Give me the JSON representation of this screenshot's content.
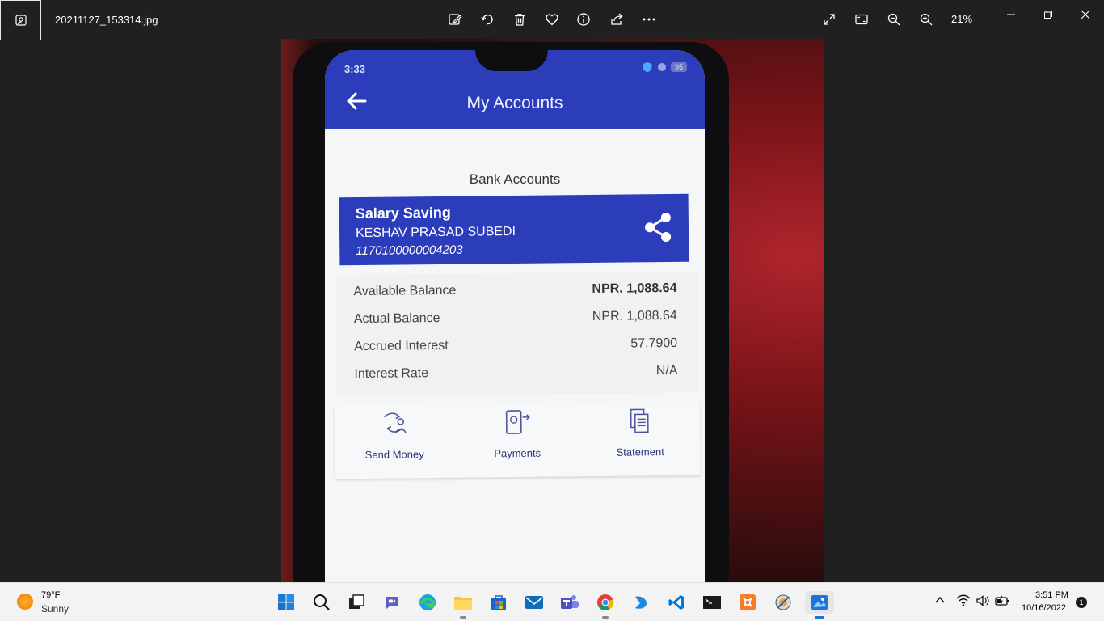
{
  "titlebar": {
    "filename": "20211127_153314.jpg",
    "zoom": "21%"
  },
  "phone": {
    "status_time": "3:33",
    "battery": "95",
    "app_title": "My Accounts",
    "section_title": "Bank Accounts",
    "account": {
      "name": "Salary Saving",
      "holder": "KESHAV PRASAD  SUBEDI",
      "number": "1170100000004203"
    },
    "balances": [
      {
        "label": "Available Balance",
        "value": "NPR. 1,088.64"
      },
      {
        "label": "Actual Balance",
        "value": "NPR. 1,088.64"
      },
      {
        "label": "Accrued Interest",
        "value": "57.7900"
      },
      {
        "label": "Interest Rate",
        "value": "N/A"
      }
    ],
    "actions": [
      {
        "label": "Send Money"
      },
      {
        "label": "Payments"
      },
      {
        "label": "Statement"
      }
    ]
  },
  "taskbar": {
    "weather_temp": "79°F",
    "weather_cond": "Sunny",
    "clock_time": "3:51 PM",
    "clock_date": "10/16/2022",
    "notifications": "1"
  }
}
